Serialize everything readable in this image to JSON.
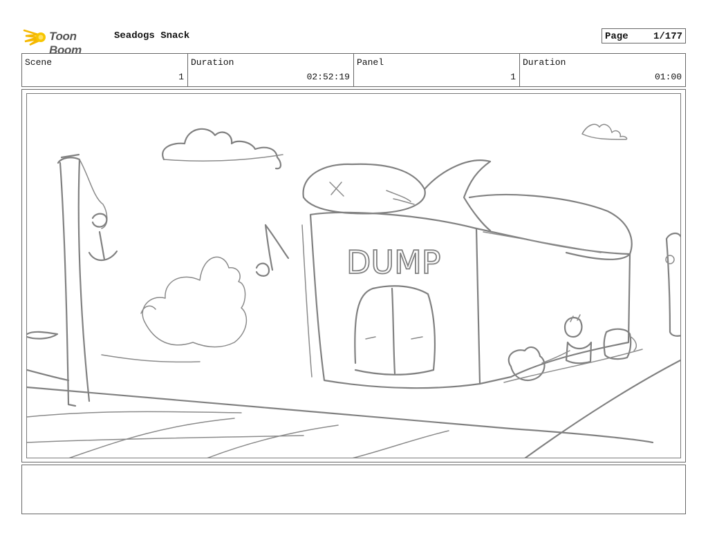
{
  "header": {
    "logo_text": "Toon Boom",
    "project_title": "Seadogs Snack",
    "page_label": "Page",
    "page_value": "1/177"
  },
  "info": [
    {
      "label": "Scene",
      "value": "1"
    },
    {
      "label": "Duration",
      "value": "02:52:19"
    },
    {
      "label": "Panel",
      "value": "1"
    },
    {
      "label": "Duration",
      "value": "01:00"
    }
  ],
  "panel": {
    "sketch_text": "DUMP"
  },
  "notes": {
    "text": ""
  }
}
